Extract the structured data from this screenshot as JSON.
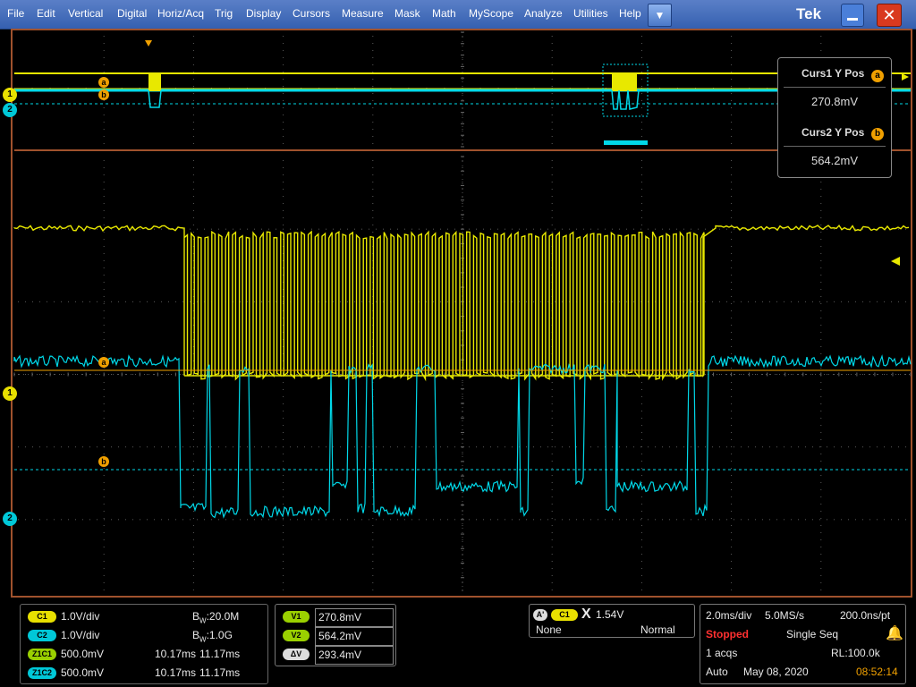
{
  "menu": {
    "items": [
      "File",
      "Edit",
      "Vertical",
      "Digital",
      "Horiz/Acq",
      "Trig",
      "Display",
      "Cursors",
      "Measure",
      "Mask",
      "Math",
      "MyScope",
      "Analyze",
      "Utilities",
      "Help"
    ],
    "dropdown_glyph": "▼",
    "brand": "Tek",
    "close_glyph": "✕"
  },
  "markers": {
    "cursor_a": "a",
    "cursor_b": "b",
    "ch1": "1",
    "ch2": "2"
  },
  "cursor_readout": {
    "curs1_label": "Curs1 Y Pos",
    "curs1_value": "270.8mV",
    "curs2_label": "Curs2 Y Pos",
    "curs2_value": "564.2mV"
  },
  "channels": {
    "c1": {
      "badge": "C1",
      "scale": "1.0V/div",
      "bw_prefix": "B",
      "bw_sub": "W",
      "bw_value": ":20.0M"
    },
    "c2": {
      "badge": "C2",
      "scale": "1.0V/div",
      "bw_prefix": "B",
      "bw_sub": "W",
      "bw_value": ":1.0G"
    },
    "z1c1": {
      "badge": "Z1C1",
      "scale": "500.0mV",
      "t1": "10.17ms",
      "t2": "11.17ms"
    },
    "z1c2": {
      "badge": "Z1C2",
      "scale": "500.0mV",
      "t1": "10.17ms",
      "t2": "11.17ms"
    }
  },
  "cursor_values": {
    "v1_label": "V1",
    "v1": "270.8mV",
    "v2_label": "V2",
    "v2": "564.2mV",
    "dv_label": "ΔV",
    "dv": "293.4mV"
  },
  "trigger": {
    "a_badge": "A'",
    "src_badge": "C1",
    "slope_glyph": "X",
    "level": "1.54V",
    "coupling": "None",
    "mode": "Normal"
  },
  "acquisition": {
    "timebase": "2.0ms/div",
    "sample_rate": "5.0MS/s",
    "resolution": "200.0ns/pt",
    "state": "Stopped",
    "seq_mode": "Single Seq",
    "acqs": "1 acqs",
    "record_length": "RL:100.0k",
    "auto": "Auto",
    "date": "May 08, 2020",
    "time": "08:52:14"
  },
  "colors": {
    "ch1": "#e8e800",
    "ch2": "#00d8e8",
    "cursor": "#f0a000",
    "stopped": "#ff3030",
    "clock": "#f0a000"
  }
}
